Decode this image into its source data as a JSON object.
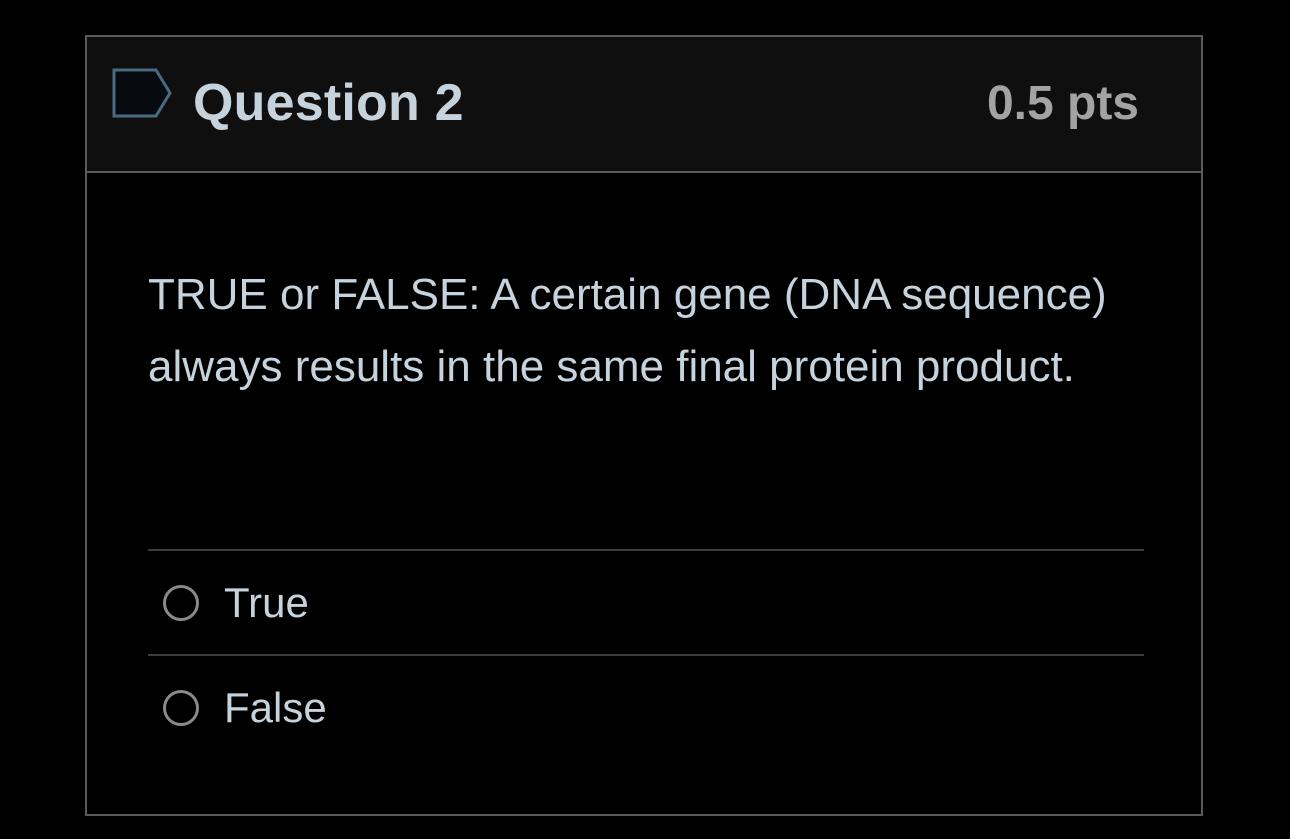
{
  "question": {
    "title": "Question 2",
    "points": "0.5 pts",
    "flag_icon": "flag-icon",
    "text": "TRUE or FALSE: A certain gene (DNA sequence) always results in the same final protein product.",
    "answers": [
      {
        "label": "True",
        "selected": false
      },
      {
        "label": "False",
        "selected": false
      }
    ]
  },
  "colors": {
    "background": "#000000",
    "header_background": "#0f0f0f",
    "text": "#c6d2dc",
    "points": "#a3a3a3",
    "border": "#5a5a5a",
    "flag_stroke": "#4a6a82"
  }
}
